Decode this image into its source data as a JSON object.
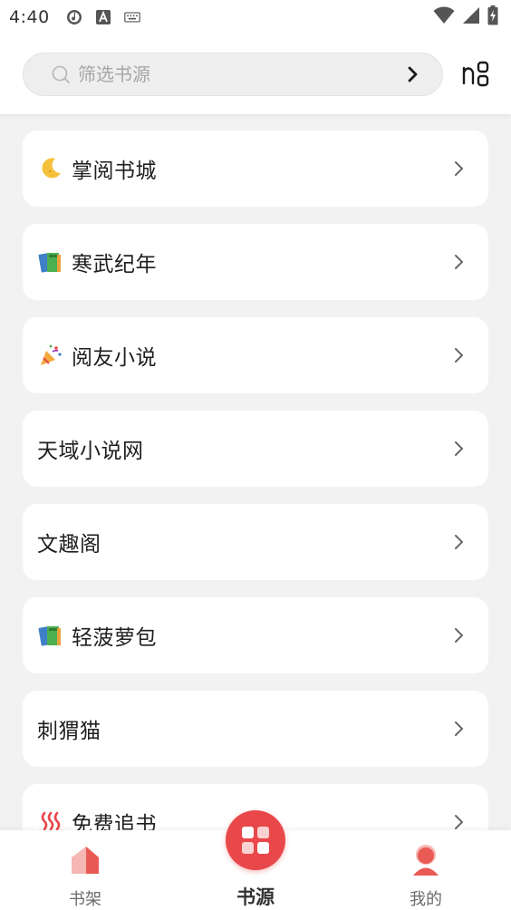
{
  "status_bar": {
    "time": "4:40",
    "left_icons": [
      "music-notification-icon",
      "text-a-icon",
      "keyboard-icon"
    ],
    "right_icons": [
      "wifi-icon",
      "signal-icon",
      "battery-charging-icon"
    ]
  },
  "header": {
    "search": {
      "placeholder": "筛选书源",
      "value": ""
    },
    "go_icon": "chevron-right-icon",
    "scan_icon": "scan-icon"
  },
  "sources": [
    {
      "label": "掌阅书城",
      "emoji": "🌙",
      "icon": "crescent-moon-icon"
    },
    {
      "label": "寒武纪年",
      "emoji": "📚",
      "icon": "books-icon"
    },
    {
      "label": "阅友小说",
      "emoji": "🎉",
      "icon": "party-popper-icon"
    },
    {
      "label": "天域小说网",
      "emoji": "",
      "icon": ""
    },
    {
      "label": "文趣阁",
      "emoji": "",
      "icon": ""
    },
    {
      "label": "轻菠萝包",
      "emoji": "📚",
      "icon": "books-icon"
    },
    {
      "label": "刺猬猫",
      "emoji": "",
      "icon": ""
    },
    {
      "label": "免费追书",
      "emoji": "♨",
      "icon": "hot-springs-icon"
    }
  ],
  "bottom_nav": {
    "shelf_label": "书架",
    "source_label": "书源",
    "mine_label": "我的",
    "active": "source"
  },
  "colors": {
    "accent": "#e9484a",
    "background": "#f2f2f2",
    "card": "#ffffff",
    "placeholder": "#a6a6a6"
  }
}
